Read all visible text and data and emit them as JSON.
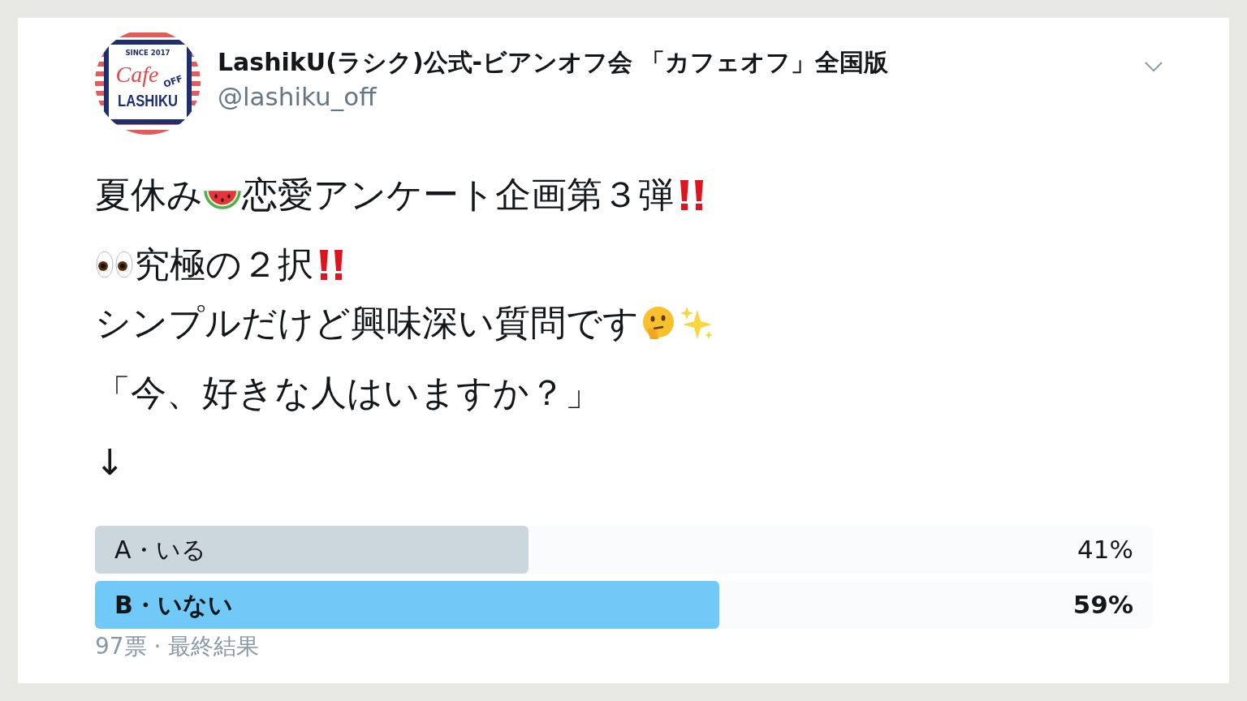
{
  "author": {
    "avatar": {
      "tagline": "SINCE 2017",
      "script": "Cafe",
      "badge": "OFF",
      "wordmark": "LASHIKU"
    },
    "name": "LashikU(ラシク)公式-ビアンオフ会 「カフェオフ」全国版",
    "handle": "@lashiku_off"
  },
  "paragraphs": [
    [
      [
        {
          "kind": "text",
          "text": "夏休み"
        },
        {
          "kind": "watermelon"
        },
        {
          "kind": "text",
          "text": "恋愛アンケート企画第３弾"
        },
        {
          "kind": "double-exclamation"
        }
      ]
    ],
    [
      [
        {
          "kind": "eyes"
        },
        {
          "kind": "text",
          "text": "究極の２択"
        },
        {
          "kind": "double-exclamation"
        }
      ],
      [
        {
          "kind": "text",
          "text": "シンプルだけど興味深い質問です"
        },
        {
          "kind": "thinking"
        },
        {
          "kind": "sparkles"
        }
      ]
    ],
    [
      [
        {
          "kind": "text",
          "text": "「今、好きな人はいますか？」"
        }
      ]
    ],
    [
      [
        {
          "kind": "text",
          "text": "↓"
        }
      ]
    ]
  ],
  "poll": {
    "options": [
      {
        "label": "A・いる",
        "percent": "41%",
        "level": 0.41,
        "winner": false
      },
      {
        "label": "B・いない",
        "percent": "59%",
        "level": 0.59,
        "winner": true
      }
    ],
    "footer": "97票 · 最終結果"
  }
}
